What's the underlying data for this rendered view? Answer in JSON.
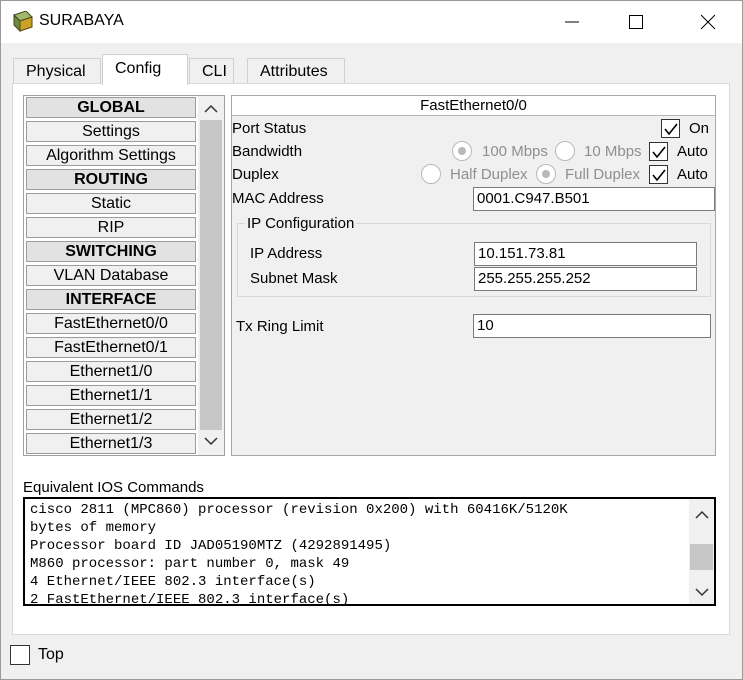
{
  "window": {
    "title": "SURABAYA",
    "icon": "router-device-icon"
  },
  "tabs": [
    {
      "label": "Physical"
    },
    {
      "label": "Config",
      "active": true
    },
    {
      "label": "CLI"
    },
    {
      "label": "Attributes"
    }
  ],
  "nav": {
    "items": [
      {
        "label": "GLOBAL",
        "header": true
      },
      {
        "label": "Settings"
      },
      {
        "label": "Algorithm Settings"
      },
      {
        "label": "ROUTING",
        "header": true
      },
      {
        "label": "Static"
      },
      {
        "label": "RIP"
      },
      {
        "label": "SWITCHING",
        "header": true
      },
      {
        "label": "VLAN Database"
      },
      {
        "label": "INTERFACE",
        "header": true
      },
      {
        "label": "FastEthernet0/0"
      },
      {
        "label": "FastEthernet0/1"
      },
      {
        "label": "Ethernet1/0"
      },
      {
        "label": "Ethernet1/1"
      },
      {
        "label": "Ethernet1/2"
      },
      {
        "label": "Ethernet1/3"
      }
    ]
  },
  "panel": {
    "title": "FastEthernet0/0",
    "port_status": {
      "label": "Port Status",
      "on_label": "On",
      "checked": true
    },
    "bandwidth": {
      "label": "Bandwidth",
      "opt1": "100 Mbps",
      "opt2": "10 Mbps",
      "auto_label": "Auto",
      "auto_checked": true
    },
    "duplex": {
      "label": "Duplex",
      "opt1": "Half Duplex",
      "opt2": "Full Duplex",
      "auto_label": "Auto",
      "auto_checked": true
    },
    "mac": {
      "label": "MAC Address",
      "value": "0001.C947.B501"
    },
    "ip_config": {
      "title": "IP Configuration",
      "ip_label": "IP Address",
      "ip_value": "10.151.73.81",
      "mask_label": "Subnet Mask",
      "mask_value": "255.255.255.252"
    },
    "tx_ring": {
      "label": "Tx Ring Limit",
      "value": "10"
    }
  },
  "ios": {
    "label": "Equivalent IOS Commands",
    "text": "cisco 2811 (MPC860) processor (revision 0x200) with 60416K/5120K\nbytes of memory\nProcessor board ID JAD05190MTZ (4292891495)\nM860 processor: part number 0, mask 49\n4 Ethernet/IEEE 802.3 interface(s)\n2 FastEthernet/IEEE 802.3 interface(s)"
  },
  "footer": {
    "top_label": "Top",
    "top_checked": false
  }
}
